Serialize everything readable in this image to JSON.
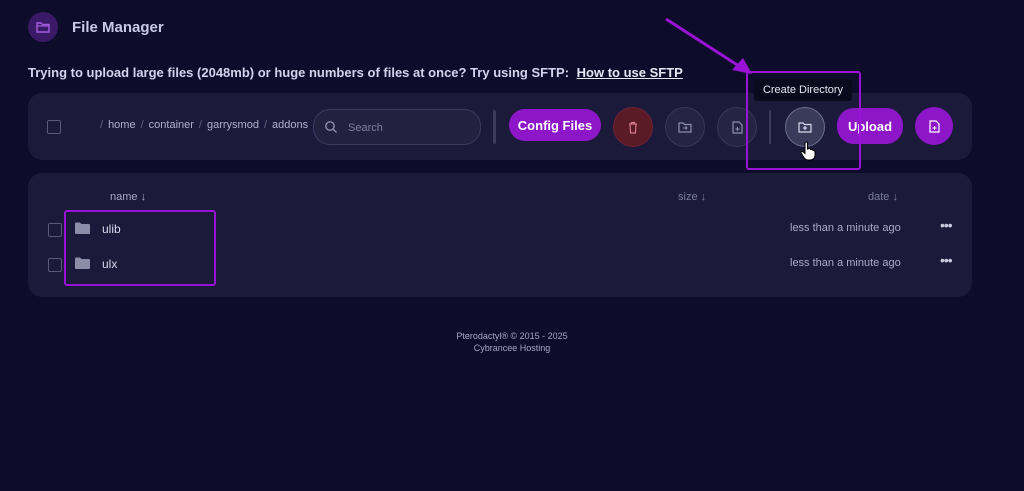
{
  "header": {
    "title": "File Manager",
    "icon": "folder-icon"
  },
  "notice": {
    "text": "Trying to upload large files (2048mb) or huge numbers of files at once? Try using SFTP:",
    "link": "How to use SFTP"
  },
  "breadcrumbs": [
    "home",
    "container",
    "garrysmod",
    "addons"
  ],
  "search": {
    "placeholder": "Search"
  },
  "toolbar": {
    "config_label": "Config Files",
    "upload_label": "Upload",
    "tooltip": "Create Directory"
  },
  "table": {
    "headers": {
      "name": "name ↓",
      "size": "size ↓",
      "date": "date ↓"
    },
    "rows": [
      {
        "name": "ulib",
        "date": "less than a minute ago",
        "menu": "•••"
      },
      {
        "name": "ulx",
        "date": "less than a minute ago",
        "menu": "•••"
      }
    ]
  },
  "footer": {
    "line1": "Pterodactyl® © 2015 - 2025",
    "line2": "Cybrancee Hosting"
  },
  "colors": {
    "accent": "#8e16c9",
    "background": "#0d0c2b",
    "panel": "#1b1a3a",
    "annotation": "#9a12d6"
  }
}
